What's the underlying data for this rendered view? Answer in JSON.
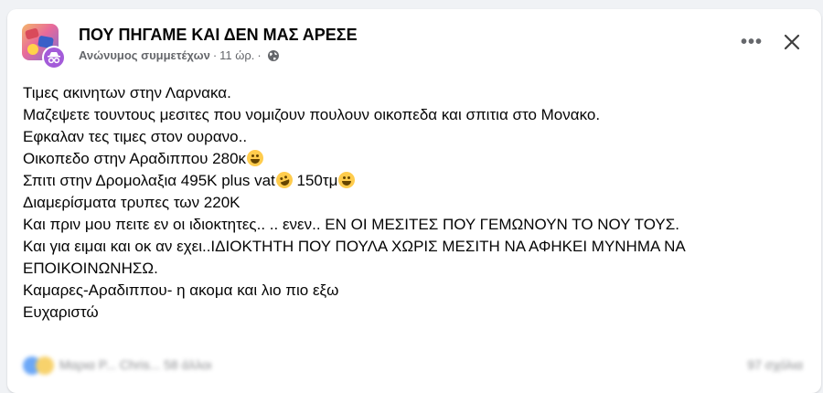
{
  "post": {
    "group_name": "ΠΟΥ ΠΗΓΑΜΕ ΚΑΙ ΔΕΝ ΜΑΣ ΑΡΕΣΕ",
    "author": "Ανώνυμος συμμετέχων",
    "dot": "·",
    "time": "11 ώρ.",
    "privacy_icon": "globe-icon",
    "more_label": "•••",
    "close_icon": "close-icon",
    "lines": [
      "Τιμες ακινητων στην Λαρνακα.",
      "Μαζεψετε τουντους μεσιτες που νομιζουν πουλουν οικοπεδα και σπιτια στο Μονακο.",
      "Εφκαλαν τες τιμες στον ουρανο..",
      "Οικοπεδο στην Αραδιππου 280κ",
      "Σπιτι στην Δρομολαξια  495K plus vat",
      " 150τμ",
      "Διαμερίσματα τρυπες των 220Κ",
      "Και πριν μου πειτε εν οι ιδιοκτητες.. .. ενεν.. ΕΝ ΟΙ ΜΕΣΙΤΕΣ ΠΟΥ ΓΕΜΩΝΟΥΝ ΤΟ ΝΟΥ ΤΟΥΣ.",
      "Και για ειμαι και οκ αν εχει..ΙΔΙΟΚΤΗΤΗ ΠΟΥ ΠΟΥΛΑ ΧΩΡΙΣ ΜΕΣΙΤΗ ΝΑ ΑΦΗΚΕΙ ΜΥΝΗΜΑ ΝΑ ΕΠΟΙΚΟΙΝΩΝΗΣΩ.",
      "Καμαρες-Αραδιππου- η ακομα και λιο πιο εξω",
      "Ευχαριστώ"
    ],
    "emoji_icons": [
      "grinning-squint-emoji",
      "rolling-laughing-emoji",
      "smiling-emoji"
    ]
  },
  "footer": {
    "reactions_text": "Μαρια Ρ... Chris... 58 άλλοι",
    "comments_text": "97 σχόλια"
  },
  "colors": {
    "page_bg": "#f0f2f5",
    "card_bg": "#ffffff",
    "text_primary": "#050505",
    "text_secondary": "#65676b",
    "anon_badge": "#a35bd9"
  }
}
